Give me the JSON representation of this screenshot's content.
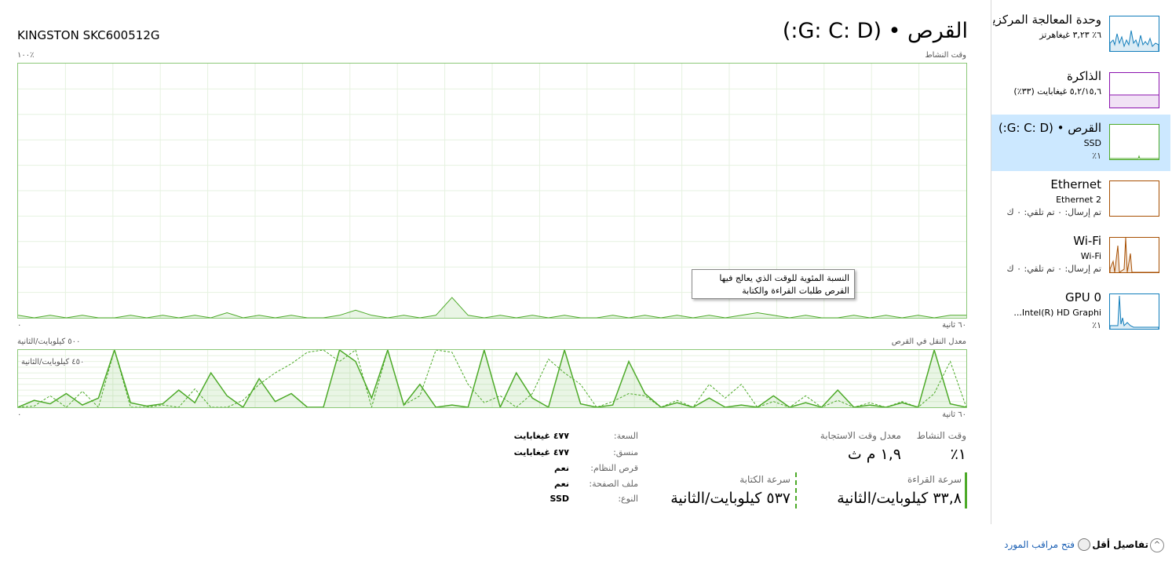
{
  "header": {
    "title": "القرص • (G: C: D:)",
    "model": "KINGSTON SKC600512G"
  },
  "activity_graph": {
    "label": "وقت النشاط",
    "max_label": "١٠٠٪",
    "time_label": "٦٠ ثانية",
    "min_label": "٠"
  },
  "transfer_graph": {
    "label": "معدل النقل في القرص",
    "max_label": "٥٠٠ كيلوبايت/الثانية",
    "mid_label": "٤٥٠ كيلوبايت/الثانية",
    "time_label": "٦٠ ثانية",
    "min_label": "٠"
  },
  "tooltip": {
    "line1": "النسبة المئوية للوقت الذي يعالج فيها",
    "line2": "القرص طلبات القراءة والكتابة"
  },
  "stats": {
    "active_time_label": "وقت النشاط",
    "active_time_value": "١٪",
    "response_label": "معدل وقت الاستجابة",
    "response_value": "١,٩ م ث",
    "read_label": "سرعة القراءة",
    "read_value": "٣٣,٨ كيلوبايت/الثانية",
    "write_label": "سرعة الكتابة",
    "write_value": "٥٣٧ كيلوبايت/الثانية"
  },
  "info": {
    "capacity_label": "السعة:",
    "capacity_value": "٤٧٧ غيغابايت",
    "formatted_label": "منسق:",
    "formatted_value": "٤٧٧ غيغابايت",
    "system_label": "قرص النظام:",
    "system_value": "نعم",
    "pagefile_label": "ملف الصفحة:",
    "pagefile_value": "نعم",
    "type_label": "النوع:",
    "type_value": "SSD"
  },
  "sidebar": {
    "items": [
      {
        "title": "وحدة المعالجة المركزية",
        "sub": "٦٪ ٣,٢٣ غيغاهرتز",
        "val": ""
      },
      {
        "title": "الذاكرة",
        "sub": "٥,٢/١٥,٦ غيغابايت (٣٣٪)",
        "val": ""
      },
      {
        "title": "القرص • (G: C: D:)",
        "sub": "SSD",
        "val": "١٪"
      },
      {
        "title": "Ethernet",
        "sub": "Ethernet 2",
        "val": "تم إرسال: ٠ تم تلقي: ٠ ك"
      },
      {
        "title": "Wi-Fi",
        "sub": "Wi-Fi",
        "val": "تم إرسال: ٠ تم تلقي: ٠ ك"
      },
      {
        "title": "GPU 0",
        "sub": "Intel(R) HD Graphi...",
        "val": "١٪"
      }
    ]
  },
  "footer": {
    "fewer_details": "تفاصيل أقل",
    "resource_monitor": "فتح مراقب المورد"
  },
  "colors": {
    "disk_green": "#4daa29",
    "cpu_blue": "#117dbb",
    "memory_purple": "#8b12ae",
    "network_orange": "#a74f01",
    "selected_bg": "#cce8ff"
  },
  "chart_data": [
    {
      "type": "area",
      "label": "وقت النشاط",
      "ylim": [
        0,
        100
      ],
      "values": [
        1,
        0,
        1,
        0,
        1,
        0,
        0,
        1,
        0,
        1,
        0,
        1,
        0,
        2,
        0,
        1,
        0,
        1,
        0,
        0,
        1,
        3,
        1,
        0,
        1,
        0,
        1,
        8,
        1,
        0,
        1,
        0,
        1,
        0,
        1,
        0,
        0,
        1,
        0,
        1,
        0,
        1,
        0,
        1,
        0,
        1,
        2,
        1,
        0,
        1,
        0,
        0,
        1,
        0,
        1,
        0,
        1,
        0,
        1,
        1
      ]
    },
    {
      "type": "line",
      "label": "معدل النقل في القرص",
      "ylim": [
        0,
        500
      ],
      "series": [
        {
          "values": [
            0,
            60,
            30,
            120,
            20,
            80,
            500,
            40,
            10,
            30,
            150,
            40,
            300,
            100,
            0,
            250,
            50,
            120,
            0,
            0,
            500,
            400,
            80,
            500,
            20,
            200,
            0,
            20,
            0,
            500,
            0,
            300,
            80,
            0,
            500,
            30,
            0,
            20,
            400,
            120,
            0,
            40,
            0,
            80,
            0,
            20,
            0,
            100,
            0,
            40,
            0,
            150,
            0,
            20,
            0,
            40,
            0,
            500,
            30,
            0
          ]
        },
        {
          "values": [
            0,
            10,
            100,
            0,
            140,
            0,
            500,
            0,
            0,
            20,
            0,
            160,
            0,
            0,
            60,
            200,
            300,
            380,
            480,
            500,
            400,
            500,
            0,
            500,
            20,
            100,
            500,
            480,
            200,
            40,
            100,
            0,
            120,
            420,
            300,
            200,
            0,
            50,
            120,
            100,
            0,
            60,
            0,
            200,
            80,
            200,
            0,
            50,
            0,
            100,
            0,
            60,
            0,
            40,
            0,
            50,
            0,
            120,
            400,
            0
          ]
        }
      ]
    }
  ]
}
